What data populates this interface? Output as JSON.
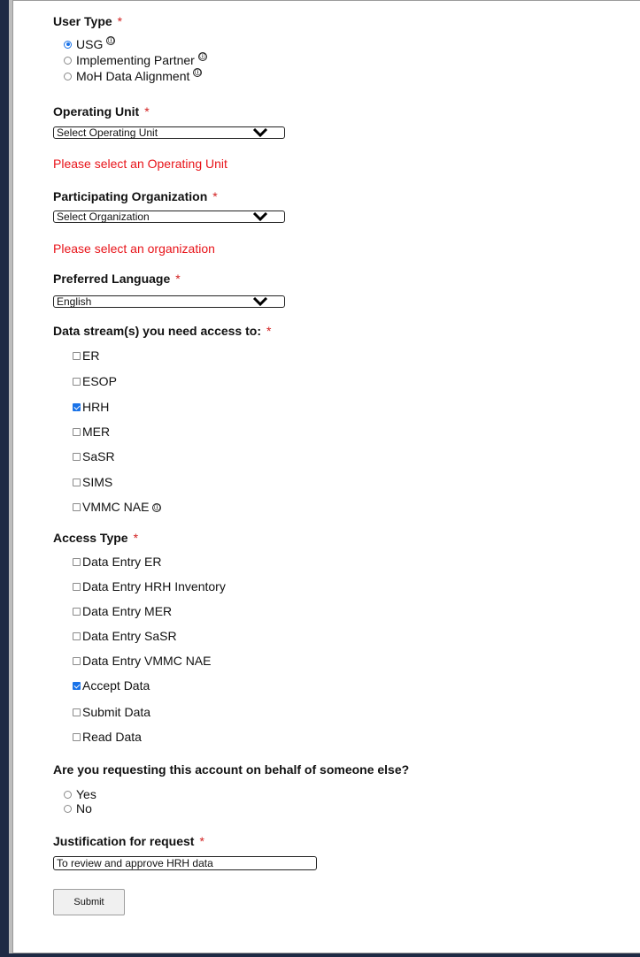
{
  "user_type": {
    "label": "User Type",
    "required": "*",
    "options": [
      {
        "label": "USG",
        "selected": true
      },
      {
        "label": "Implementing Partner",
        "selected": false
      },
      {
        "label": "MoH Data Alignment",
        "selected": false
      }
    ],
    "info_glyph": "ⓘ"
  },
  "operating_unit": {
    "label": "Operating Unit",
    "required": "*",
    "value": "Select Operating Unit",
    "error": "Please select an Operating Unit"
  },
  "organization": {
    "label": "Participating Organization",
    "required": "*",
    "value": "Select Organization",
    "error": "Please select an organization"
  },
  "language": {
    "label": "Preferred Language",
    "required": "*",
    "value": "English"
  },
  "data_streams": {
    "label": "Data stream(s) you need access to:",
    "required": "*",
    "items": [
      {
        "label": "ER",
        "checked": false
      },
      {
        "label": "ESOP",
        "checked": false
      },
      {
        "label": "HRH",
        "checked": true
      },
      {
        "label": "MER",
        "checked": false
      },
      {
        "label": "SaSR",
        "checked": false
      },
      {
        "label": "SIMS",
        "checked": false
      },
      {
        "label": "VMMC NAE",
        "checked": false
      }
    ]
  },
  "access_type": {
    "label": "Access Type",
    "required": "*",
    "items": [
      {
        "label": "Data Entry ER",
        "checked": false
      },
      {
        "label": "Data Entry HRH Inventory",
        "checked": false
      },
      {
        "label": "Data Entry MER",
        "checked": false
      },
      {
        "label": "Data Entry SaSR",
        "checked": false
      },
      {
        "label": "Data Entry VMMC NAE",
        "checked": false
      },
      {
        "label": "Accept Data",
        "checked": true
      },
      {
        "label": "Submit Data",
        "checked": false
      },
      {
        "label": "Read Data",
        "checked": false
      }
    ]
  },
  "behalf": {
    "label": "Are you requesting this account on behalf of someone else?",
    "options": [
      {
        "label": "Yes",
        "selected": false
      },
      {
        "label": "No",
        "selected": false
      }
    ]
  },
  "justification": {
    "label": "Justification for request",
    "required": "*",
    "value": "To review and approve HRH data"
  },
  "submit_label": "Submit",
  "colors": {
    "accent": "#1a73e8",
    "error": "#e8141a",
    "required": "#d21f1f",
    "frame": "#1e2a44"
  }
}
